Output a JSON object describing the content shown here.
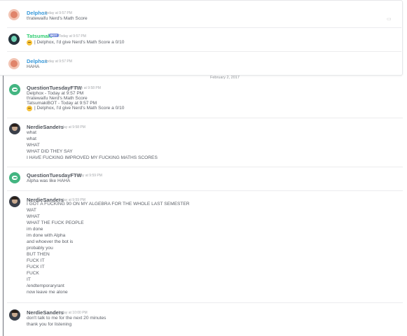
{
  "quoted": {
    "messages": [
      {
        "author": "Delphox",
        "author_color": "#3498db",
        "timestamp": "Today at 9:57 PM",
        "lines": [
          "t!ratewaifu Nerd's Math Score"
        ]
      },
      {
        "author": "Tatsumaki",
        "author_color": "#2ecc71",
        "bot_tag": "BOT",
        "timestamp": "Today at 9:57 PM",
        "lines": [
          "| Delphox, I'd give Nerd's Math Score a 0/10"
        ]
      },
      {
        "author": "Delphox",
        "author_color": "#3498db",
        "timestamp": "Today at 9:57 PM",
        "lines": [
          "HAHA"
        ]
      }
    ]
  },
  "date_divider": "February 2, 2017",
  "messages": [
    {
      "author": "QuestionTuesdayFTW",
      "timestamp": "Today at 9:58 PM",
      "lines": [
        "Delphox - Today at 9:57 PM",
        "t!ratewaifu Nerd's Math Score",
        "TatsumakiBOT - Today at 9:57 PM",
        "| Delphox, I'd give Nerd's Math Score a 0/10"
      ]
    },
    {
      "author": "NerdieSanders",
      "timestamp": "Today at 9:58 PM",
      "lines": [
        "what",
        "what",
        "WHAT",
        "WHAT DID THEY SAY",
        "I HAVE FUCKING IMPROVED MY FUCKING MATHS SCORES"
      ]
    },
    {
      "author": "QuestionTuesdayFTW",
      "timestamp": "Today at 9:59 PM",
      "lines": [
        "Alpha was like HAHA"
      ]
    },
    {
      "author": "NerdieSanders",
      "timestamp": "Today at 9:59 PM",
      "lines": [
        "I GOT A FUCKING 90 ON MY ALGEBRA FOR THE WHOLE LAST SEMESTER",
        "WAT",
        "WHAT",
        "WHAT THE FUCK PEOPLE",
        "im done",
        "im done with Alpha",
        "and whoever the bot is",
        "probably you",
        "BUT THEN",
        "FUCK IT",
        "FUCK IT",
        "FUCK",
        "IT",
        "/endtemporaryrant",
        "now leave me alone"
      ]
    },
    {
      "author": "NerdieSanders",
      "timestamp": "Today at 10:00 PM",
      "lines": [
        "don't talk to me for the next 20 minutes",
        "thank you for listening"
      ]
    }
  ]
}
